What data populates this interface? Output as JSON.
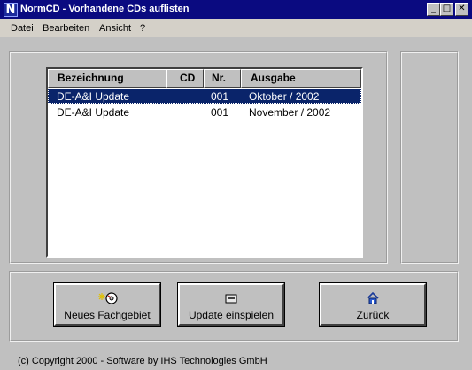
{
  "window": {
    "title": "NormCD - Vorhandene CDs auflisten",
    "icon_letter": "N",
    "minimize_glyph": "_",
    "maximize_glyph": "□",
    "close_glyph": "✕"
  },
  "menu": {
    "items": [
      {
        "label": "Datei"
      },
      {
        "label": "Bearbeiten"
      },
      {
        "label": "Ansicht"
      },
      {
        "label": "?"
      }
    ]
  },
  "list": {
    "columns": [
      "Bezeichnung",
      "CD",
      "Nr.",
      "Ausgabe"
    ],
    "rows": [
      {
        "bezeichnung": "DE-A&I Update",
        "cd": "",
        "nr": "001",
        "ausgabe": "Oktober / 2002",
        "selected": true
      },
      {
        "bezeichnung": "DE-A&I Update",
        "cd": "",
        "nr": "001",
        "ausgabe": "November / 2002",
        "selected": false
      }
    ]
  },
  "buttons": {
    "new_field": {
      "label": "Neues Fachgebiet",
      "icon": "sparkle-cd-icon"
    },
    "update": {
      "label": "Update einspielen",
      "icon": "drive-icon"
    },
    "back": {
      "label": "Zurück",
      "icon": "home-icon"
    }
  },
  "footer": {
    "text": "(c) Copyright 2000  -  Software by IHS Technologies GmbH"
  },
  "colors": {
    "titlebar": "#0a0a80",
    "selection": "#0a246a",
    "face": "#c0c0c0"
  }
}
